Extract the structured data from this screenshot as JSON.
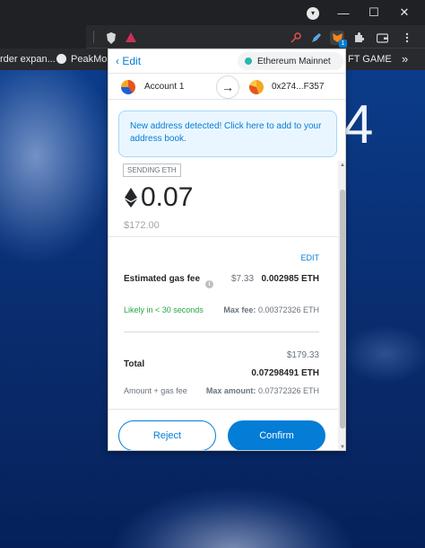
{
  "desktop": {
    "big_digit": "4"
  },
  "window": {
    "minimize_icon": "minimize-icon",
    "maximize_icon": "maximize-icon",
    "close_icon": "close-icon"
  },
  "bookmarks": {
    "item1": "rder expan...",
    "item2": "PeakMons",
    "item3": "FT GAME",
    "more": "»"
  },
  "metamask": {
    "edit_label": "Edit",
    "network": "Ethereum Mainnet",
    "from_account": "Account 1",
    "to_address": "0x274...F357",
    "notice": "New address detected! Click here to add to your address book.",
    "sending_tag": "SENDING ETH",
    "amount": "0.07",
    "amount_usd": "$172.00",
    "edit_gas": "EDIT",
    "gas_label": "Estimated gas fee",
    "gas_usd": "$7.33",
    "gas_eth": "0.002985 ETH",
    "likely": "Likely in < 30 seconds",
    "max_fee_label": "Max fee:",
    "max_fee_value": "0.00372326 ETH",
    "total_label": "Total",
    "total_usd": "$179.33",
    "total_eth": "0.07298491 ETH",
    "amount_plus_gas": "Amount + gas fee",
    "max_amount_label": "Max amount:",
    "max_amount_value": "0.07372326 ETH",
    "reject": "Reject",
    "confirm": "Confirm"
  },
  "colors": {
    "accent": "#037dd6",
    "success": "#28a745",
    "network_dot": "#29b6af"
  }
}
